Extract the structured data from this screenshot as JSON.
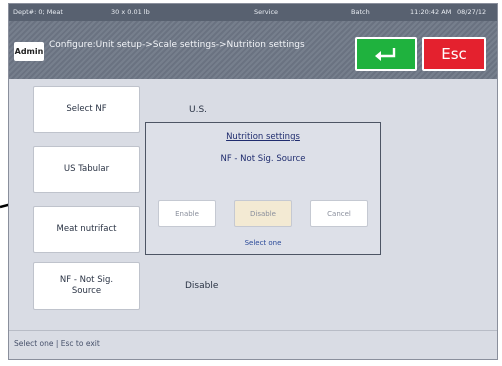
{
  "status_bar": {
    "dept": "Dept#: 0; Meat",
    "capacity": "30 x 0.01 lb",
    "mode": "Service",
    "batch": "Batch",
    "time": "11:20:42 AM",
    "date": "08/27/12"
  },
  "header": {
    "role": "Admin",
    "breadcrumb": "Configure:Unit setup->Scale settings->Nutrition settings",
    "enter_icon": "return-arrow-icon",
    "esc_label": "Esc"
  },
  "menu": [
    {
      "label": "Select NF",
      "value": "U.S."
    },
    {
      "label": "US Tabular",
      "value": ""
    },
    {
      "label": "Meat nutrifact",
      "value": ""
    },
    {
      "label": "NF - Not Sig. Source",
      "value": "Disable"
    }
  ],
  "dialog": {
    "title": "Nutrition settings",
    "subtitle": "NF - Not Sig. Source",
    "buttons": [
      "Enable",
      "Disable",
      "Cancel"
    ],
    "hint": "Select one"
  },
  "footer": {
    "hint": "Select one | Esc to exit"
  },
  "colors": {
    "enter_button": "#1fb23e",
    "esc_button": "#e4212e",
    "header_bg": "#6e7786",
    "selected_button": "#f3ead3"
  }
}
